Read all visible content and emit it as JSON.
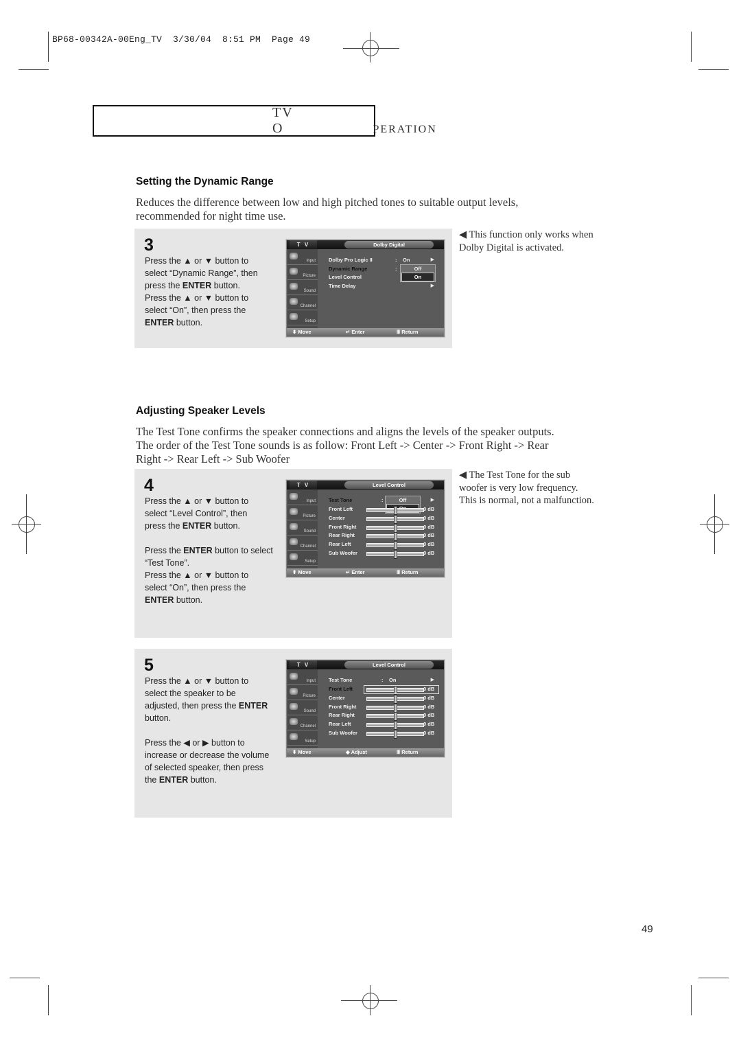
{
  "slug": "BP68-00342A-00Eng_TV  3/30/04  8:51 PM  Page 49",
  "banner": {
    "first": "TV",
    "cap": "O",
    "rest": "PERATION"
  },
  "section1": {
    "heading": "Setting the Dynamic Range",
    "intro_line1": "Reduces the difference between low and high pitched tones to suitable output levels,",
    "intro_line2": "recommended for night time use.",
    "step": {
      "number": "3",
      "lines": [
        {
          "parts": [
            {
              "t": "Press the ▲ or ▼ button to"
            }
          ]
        },
        {
          "parts": [
            {
              "t": "select “Dynamic Range”, then"
            }
          ]
        },
        {
          "parts": [
            {
              "t": "press the "
            },
            {
              "t": "ENTER",
              "b": true
            },
            {
              "t": " button."
            }
          ]
        },
        {
          "parts": [
            {
              "t": "Press the ▲ or ▼ button to"
            }
          ]
        },
        {
          "parts": [
            {
              "t": "select “On”, then press the"
            }
          ]
        },
        {
          "parts": [
            {
              "t": "ENTER",
              "b": true
            },
            {
              "t": " button."
            }
          ]
        }
      ]
    },
    "note_line1": "◀  This function only works when",
    "note_line2": "Dolby Digital is activated.",
    "osd": {
      "tv_label": "T V",
      "title": "Dolby Digital",
      "sidebar": [
        "Input",
        "Picture",
        "Sound",
        "Channel",
        "Setup"
      ],
      "rows": [
        {
          "label": "Dolby Pro Logic  II",
          "colon": ":",
          "value": "On",
          "arrow": "▶"
        },
        {
          "label": "Dynamic Range",
          "colon": ":",
          "value": "",
          "arrow": ""
        },
        {
          "label": "Level Control",
          "colon": "",
          "value": "",
          "arrow": ""
        },
        {
          "label": "Time Delay",
          "colon": "",
          "value": "",
          "arrow": "▶"
        }
      ],
      "dropdown": {
        "options": [
          "Off",
          "On"
        ],
        "selected": "On"
      },
      "footer": {
        "move": "⬍ Move",
        "enter": "↵ Enter",
        "return": "Ⅲ Return"
      }
    }
  },
  "section2": {
    "heading": "Adjusting Speaker Levels",
    "intro_line1": "The Test Tone confirms the speaker connections and aligns the levels of the speaker outputs.",
    "intro_line2": "The order of the Test Tone sounds is as follow: Front Left -> Center -> Front Right -> Rear",
    "intro_line3": "Right -> Rear Left -> Sub Woofer",
    "step4": {
      "number": "4",
      "lines": [
        {
          "parts": [
            {
              "t": "Press the ▲ or ▼ button to"
            }
          ]
        },
        {
          "parts": [
            {
              "t": "select “Level Control”, then"
            }
          ]
        },
        {
          "parts": [
            {
              "t": "press the "
            },
            {
              "t": "ENTER",
              "b": true
            },
            {
              "t": " button."
            }
          ]
        },
        {
          "parts": [
            {
              "t": ""
            }
          ]
        },
        {
          "parts": [
            {
              "t": "Press the "
            },
            {
              "t": "ENTER",
              "b": true
            },
            {
              "t": " button to select"
            }
          ]
        },
        {
          "parts": [
            {
              "t": "“Test Tone”."
            }
          ]
        },
        {
          "parts": [
            {
              "t": "Press the ▲ or ▼ button to"
            }
          ]
        },
        {
          "parts": [
            {
              "t": "select “On”, then press the"
            }
          ]
        },
        {
          "parts": [
            {
              "t": "ENTER",
              "b": true
            },
            {
              "t": " button."
            }
          ]
        }
      ]
    },
    "note_line1": "◀  The Test Tone for the sub",
    "note_line2": "woofer is very low frequency.",
    "note_line3": "This is normal, not a malfunction.",
    "osd4": {
      "tv_label": "T V",
      "title": "Level Control",
      "sidebar": [
        "Input",
        "Picture",
        "Sound",
        "Channel",
        "Setup"
      ],
      "test_tone": {
        "label": "Test Tone",
        "colon": ":",
        "value": "",
        "arrow": "▶"
      },
      "speakers": [
        {
          "label": "Front Left",
          "level": 0,
          "db": "0 dB"
        },
        {
          "label": "Center",
          "level": 0,
          "db": "0 dB"
        },
        {
          "label": "Front Right",
          "level": 0,
          "db": "0 dB"
        },
        {
          "label": "Rear Right",
          "level": 0,
          "db": "0 dB"
        },
        {
          "label": "Rear Left",
          "level": 0,
          "db": "0 dB"
        },
        {
          "label": "Sub Woofer",
          "level": 0,
          "db": "0 dB"
        }
      ],
      "dropdown": {
        "options": [
          "Off",
          "On"
        ],
        "selected": "On"
      },
      "footer": {
        "move": "⬍ Move",
        "enter": "↵ Enter",
        "return": "Ⅲ Return"
      }
    },
    "step5": {
      "number": "5",
      "lines": [
        {
          "parts": [
            {
              "t": "Press the ▲ or ▼ button to"
            }
          ]
        },
        {
          "parts": [
            {
              "t": "select the speaker to be"
            }
          ]
        },
        {
          "parts": [
            {
              "t": "adjusted, then press the "
            },
            {
              "t": "ENTER",
              "b": true
            }
          ]
        },
        {
          "parts": [
            {
              "t": "button."
            }
          ]
        },
        {
          "parts": [
            {
              "t": ""
            }
          ]
        },
        {
          "parts": [
            {
              "t": "Press the ◀ or ▶ button to"
            }
          ]
        },
        {
          "parts": [
            {
              "t": "increase or decrease the volume"
            }
          ]
        },
        {
          "parts": [
            {
              "t": "of selected speaker, then press"
            }
          ]
        },
        {
          "parts": [
            {
              "t": "the "
            },
            {
              "t": "ENTER",
              "b": true
            },
            {
              "t": " button."
            }
          ]
        }
      ]
    },
    "osd5": {
      "tv_label": "T V",
      "title": "Level Control",
      "sidebar": [
        "Input",
        "Picture",
        "Sound",
        "Channel",
        "Setup"
      ],
      "test_tone": {
        "label": "Test Tone",
        "colon": ":",
        "value": "On",
        "arrow": "▶"
      },
      "speakers": [
        {
          "label": "Front Left",
          "level": 0,
          "db": "0 dB",
          "selected": true
        },
        {
          "label": "Center",
          "level": 0,
          "db": "0 dB"
        },
        {
          "label": "Front Right",
          "level": 0,
          "db": "0 dB"
        },
        {
          "label": "Rear Right",
          "level": 0,
          "db": "0 dB"
        },
        {
          "label": "Rear Left",
          "level": 0,
          "db": "0 dB"
        },
        {
          "label": "Sub Woofer",
          "level": 0,
          "db": "0 dB"
        }
      ],
      "footer": {
        "move": "⬍ Move",
        "enter": "◆ Adjust",
        "return": "Ⅲ Return"
      }
    }
  },
  "page_number": "49"
}
